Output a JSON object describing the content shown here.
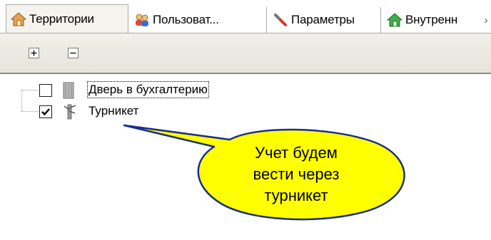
{
  "tabs": [
    {
      "label": "Территории",
      "icon": "house-icon",
      "active": true
    },
    {
      "label": "Пользоват...",
      "icon": "users-icon",
      "active": false
    },
    {
      "label": "Параметры",
      "icon": "wrench-icon",
      "active": false
    },
    {
      "label": "Внутренн",
      "icon": "house-green-icon",
      "active": false
    }
  ],
  "tab_scroll_glyph": "›",
  "toolbar": {
    "expand_icon": "plus-box-icon",
    "collapse_icon": "minus-box-icon"
  },
  "tree": {
    "items": [
      {
        "label": "Дверь в бухгалтерию",
        "checked": false,
        "icon": "door-icon",
        "focused": true
      },
      {
        "label": "Турникет",
        "checked": true,
        "icon": "turnstile-icon",
        "focused": false
      }
    ]
  },
  "callout": {
    "lines": [
      "Учет будем",
      "вести через",
      "турникет"
    ],
    "fill_color": "#ffff00",
    "border_color": "#1a2d8c"
  }
}
